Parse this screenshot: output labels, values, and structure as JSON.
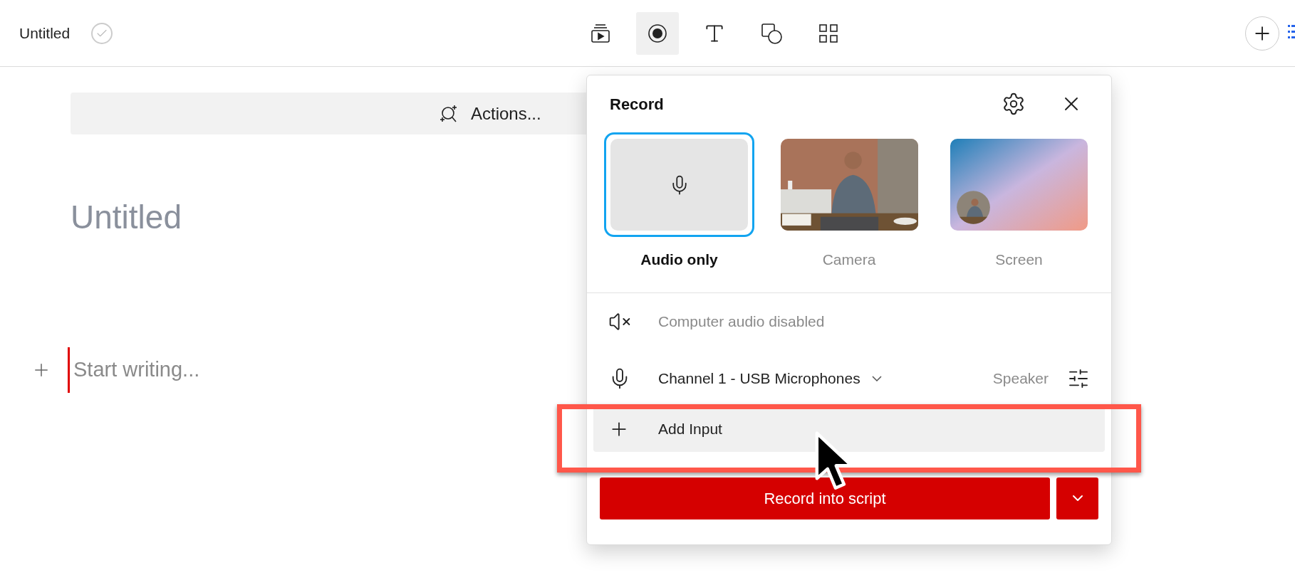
{
  "document_title": "Untitled",
  "toolbar": [
    {
      "kind": "scenes",
      "selected": false
    },
    {
      "kind": "record",
      "selected": true
    },
    {
      "kind": "text",
      "selected": false
    },
    {
      "kind": "shapes",
      "selected": false
    },
    {
      "kind": "grid",
      "selected": false
    }
  ],
  "actions_bar": {
    "label": "Actions..."
  },
  "editor": {
    "heading": "Untitled",
    "placeholder": "Start writing..."
  },
  "record_panel": {
    "title": "Record",
    "modes": [
      {
        "label": "Audio only",
        "kind": "audio",
        "selected": true
      },
      {
        "label": "Camera",
        "kind": "camera",
        "selected": false
      },
      {
        "label": "Screen",
        "kind": "screen",
        "selected": false
      }
    ],
    "rows": [
      {
        "kind": "computer-audio",
        "label": "Computer audio disabled",
        "disabled": true
      },
      {
        "kind": "device",
        "label": "Channel 1 - USB Microphones",
        "output": "Speaker",
        "disabled": false
      },
      {
        "kind": "add",
        "label": "Add Input",
        "highlighted": true,
        "disabled": false
      }
    ],
    "record_button": "Record into script"
  }
}
